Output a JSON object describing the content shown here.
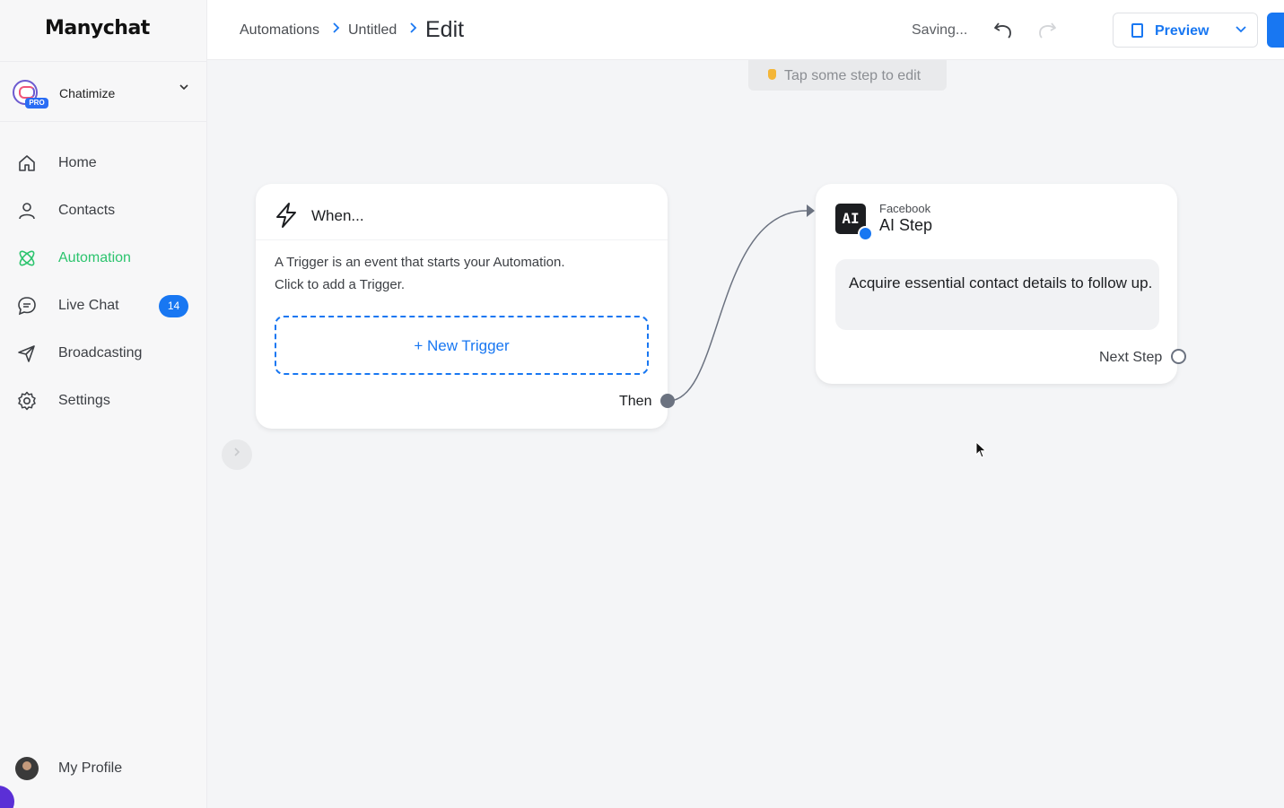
{
  "app": {
    "logo": "Manychat"
  },
  "account": {
    "name": "Chatimize",
    "badge": "PRO"
  },
  "nav": {
    "items": [
      {
        "label": "Home",
        "icon": "home-icon"
      },
      {
        "label": "Contacts",
        "icon": "contacts-icon"
      },
      {
        "label": "Automation",
        "icon": "automation-icon",
        "active": true
      },
      {
        "label": "Live Chat",
        "icon": "live-chat-icon",
        "badge": "14"
      },
      {
        "label": "Broadcasting",
        "icon": "broadcasting-icon"
      },
      {
        "label": "Settings",
        "icon": "settings-icon"
      }
    ],
    "profile": "My Profile"
  },
  "header": {
    "breadcrumb": [
      "Automations",
      "Untitled"
    ],
    "current": "Edit",
    "status": "Saving...",
    "preview_label": "Preview"
  },
  "canvas": {
    "hint": "Tap some step to edit",
    "trigger_card": {
      "title": "When...",
      "description_line1": "A Trigger is an event that starts your Automation.",
      "description_line2": "Click to add a Trigger.",
      "button": "+ New Trigger",
      "then_label": "Then"
    },
    "ai_card": {
      "badge": "AI",
      "platform": "Facebook",
      "title": "AI Step",
      "message": "Acquire essential contact details to follow up.",
      "next_label": "Next Step"
    }
  },
  "colors": {
    "accent": "#1877f2",
    "active_nav": "#2cc46e",
    "canvas_bg": "#f4f5f7"
  }
}
